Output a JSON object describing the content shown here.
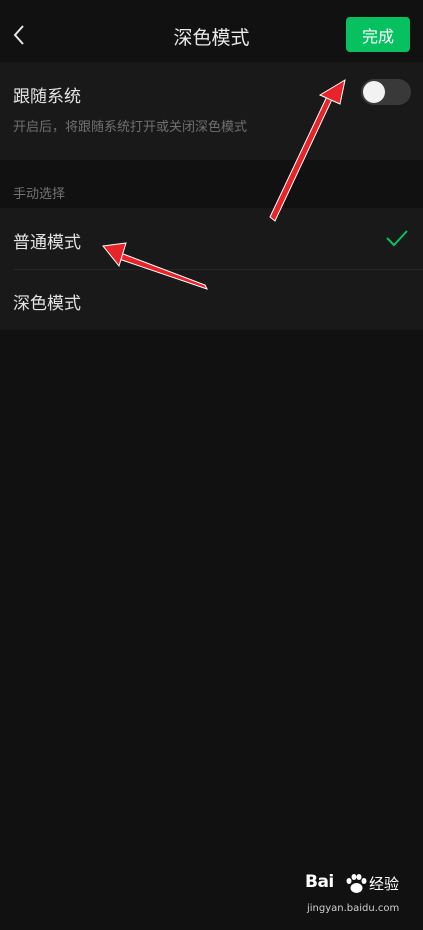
{
  "nav": {
    "title": "深色模式",
    "back_icon": "chevron-left-icon",
    "done_label": "完成",
    "accent": "#07c160"
  },
  "follow_system": {
    "title": "跟随系统",
    "description": "开启后，将跟随系统打开或关闭深色模式",
    "enabled": false
  },
  "manual": {
    "section_label": "手动选择",
    "options": [
      {
        "label": "普通模式",
        "selected": true
      },
      {
        "label": "深色模式",
        "selected": false
      }
    ]
  },
  "watermark": {
    "logo": "Bai",
    "logo_icon": "paw-icon",
    "brand": "经验",
    "url": "jingyan.baidu.com"
  },
  "annotation_color": "#e8232a"
}
